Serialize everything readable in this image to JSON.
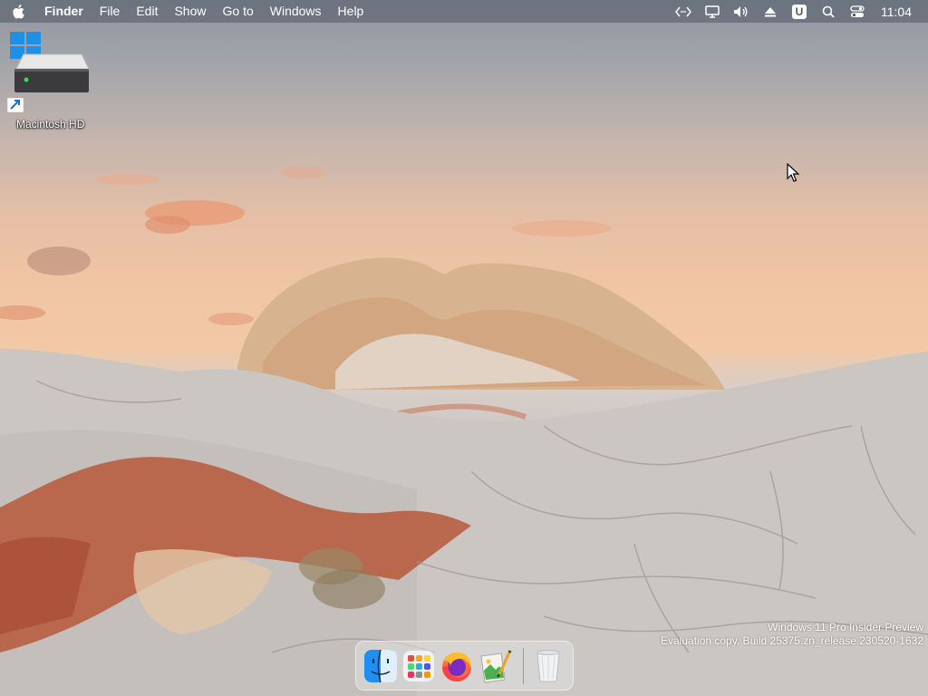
{
  "menubar": {
    "app_name": "Finder",
    "items": [
      "File",
      "Edit",
      "Show",
      "Go to",
      "Windows",
      "Help"
    ],
    "tray_icons": [
      "code-brackets-icon",
      "display-icon",
      "volume-icon",
      "eject-icon",
      "u-badge-icon",
      "search-icon",
      "control-center-icon"
    ],
    "tray_badge_letter": "U",
    "clock": "11:04"
  },
  "desktop": {
    "icons": [
      {
        "label": "Macintosh HD",
        "icon": "hard-drive-icon"
      }
    ]
  },
  "watermark": {
    "line1": "Windows 11 Pro Insider Preview",
    "line2": "Evaluation copy. Build 25375.zn_release.230520-1632"
  },
  "dock": {
    "apps": [
      "finder-icon",
      "launchpad-icon",
      "firefox-icon",
      "photo-editor-icon"
    ],
    "trash": "trash-icon"
  },
  "colors": {
    "menubar_bg": "#505864",
    "sky_top": "#8e97a3",
    "sky_glow": "#f2c9a6",
    "rock": "#c2bcb8"
  }
}
